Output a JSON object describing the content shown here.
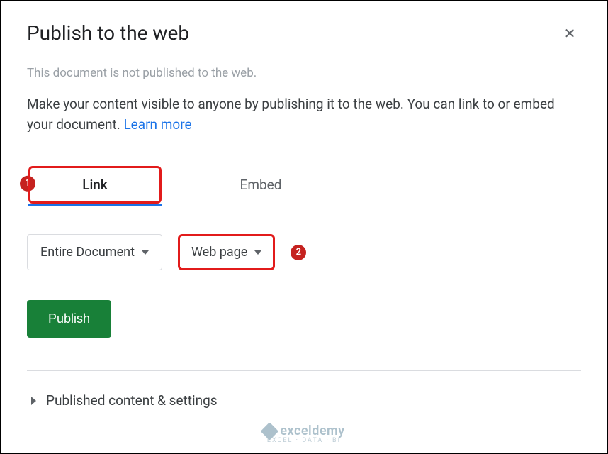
{
  "dialog": {
    "title": "Publish to the web",
    "status": "This document is not published to the web.",
    "description": "Make your content visible to anyone by publishing it to the web. You can link to or embed your document. ",
    "learn_more": "Learn more"
  },
  "tabs": {
    "link": "Link",
    "embed": "Embed"
  },
  "callouts": {
    "c1": "1",
    "c2": "2"
  },
  "selects": {
    "scope": "Entire Document",
    "format": "Web page"
  },
  "buttons": {
    "publish": "Publish"
  },
  "expander": {
    "label": "Published content & settings"
  },
  "watermark": {
    "brand": "exceldemy",
    "sub": "EXCEL · DATA · BI"
  }
}
